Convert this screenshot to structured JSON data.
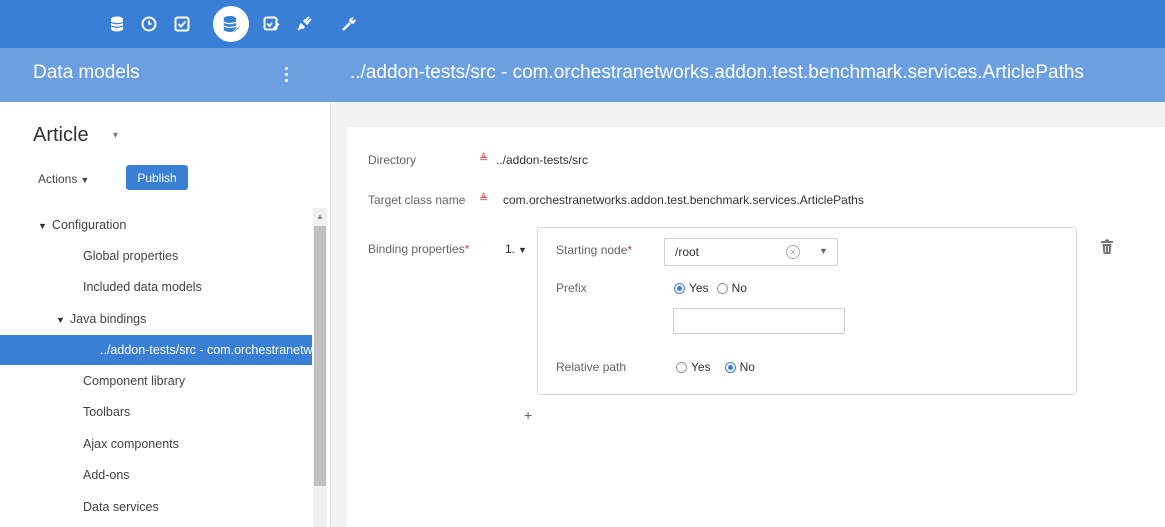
{
  "topbar": {
    "icons": [
      "database-icon",
      "clock-icon",
      "checkbox-icon",
      "data-model-icon",
      "edit-checkbox-icon",
      "plug-icon",
      "wrench-icon"
    ],
    "active_icon": "data-model-icon",
    "color": "#3a7fd6"
  },
  "subheader": {
    "panel_title": "Data models",
    "main_title": "../addon-tests/src - com.orchestranetworks.addon.test.benchmark.services.ArticlePaths",
    "color": "#6b9fe0"
  },
  "sidebar": {
    "model_name": "Article",
    "actions_label": "Actions",
    "publish_label": "Publish",
    "tree": [
      {
        "label": "Configuration",
        "expanded": true
      },
      {
        "label": "Global properties"
      },
      {
        "label": "Included data models"
      },
      {
        "label": "Java bindings",
        "expanded": true
      },
      {
        "label": "../addon-tests/src - com.orchestranetworks.addon.test.benchmark.services.ArticlePaths",
        "selected": true
      },
      {
        "label": "Component library"
      },
      {
        "label": "Toolbars"
      },
      {
        "label": "Ajax components"
      },
      {
        "label": "Add-ons"
      },
      {
        "label": "Data services"
      }
    ]
  },
  "form": {
    "directory_label": "Directory",
    "directory_value": "../addon-tests/src",
    "target_class_label": "Target class name",
    "target_class_value": "com.orchestranetworks.addon.test.benchmark.services.ArticlePaths",
    "binding_label": "Binding properties",
    "required_mark": "*",
    "item_index": "1.",
    "starting_node_label": "Starting node",
    "starting_node_value": "/root",
    "prefix_label": "Prefix",
    "prefix_yes": "Yes",
    "prefix_no": "No",
    "prefix_selected": "Yes",
    "relative_path_label": "Relative path",
    "relative_yes": "Yes",
    "relative_no": "No",
    "relative_selected": "No",
    "add_symbol": "+"
  },
  "colors": {
    "accent": "#3a7fd6",
    "required": "#d64545"
  }
}
